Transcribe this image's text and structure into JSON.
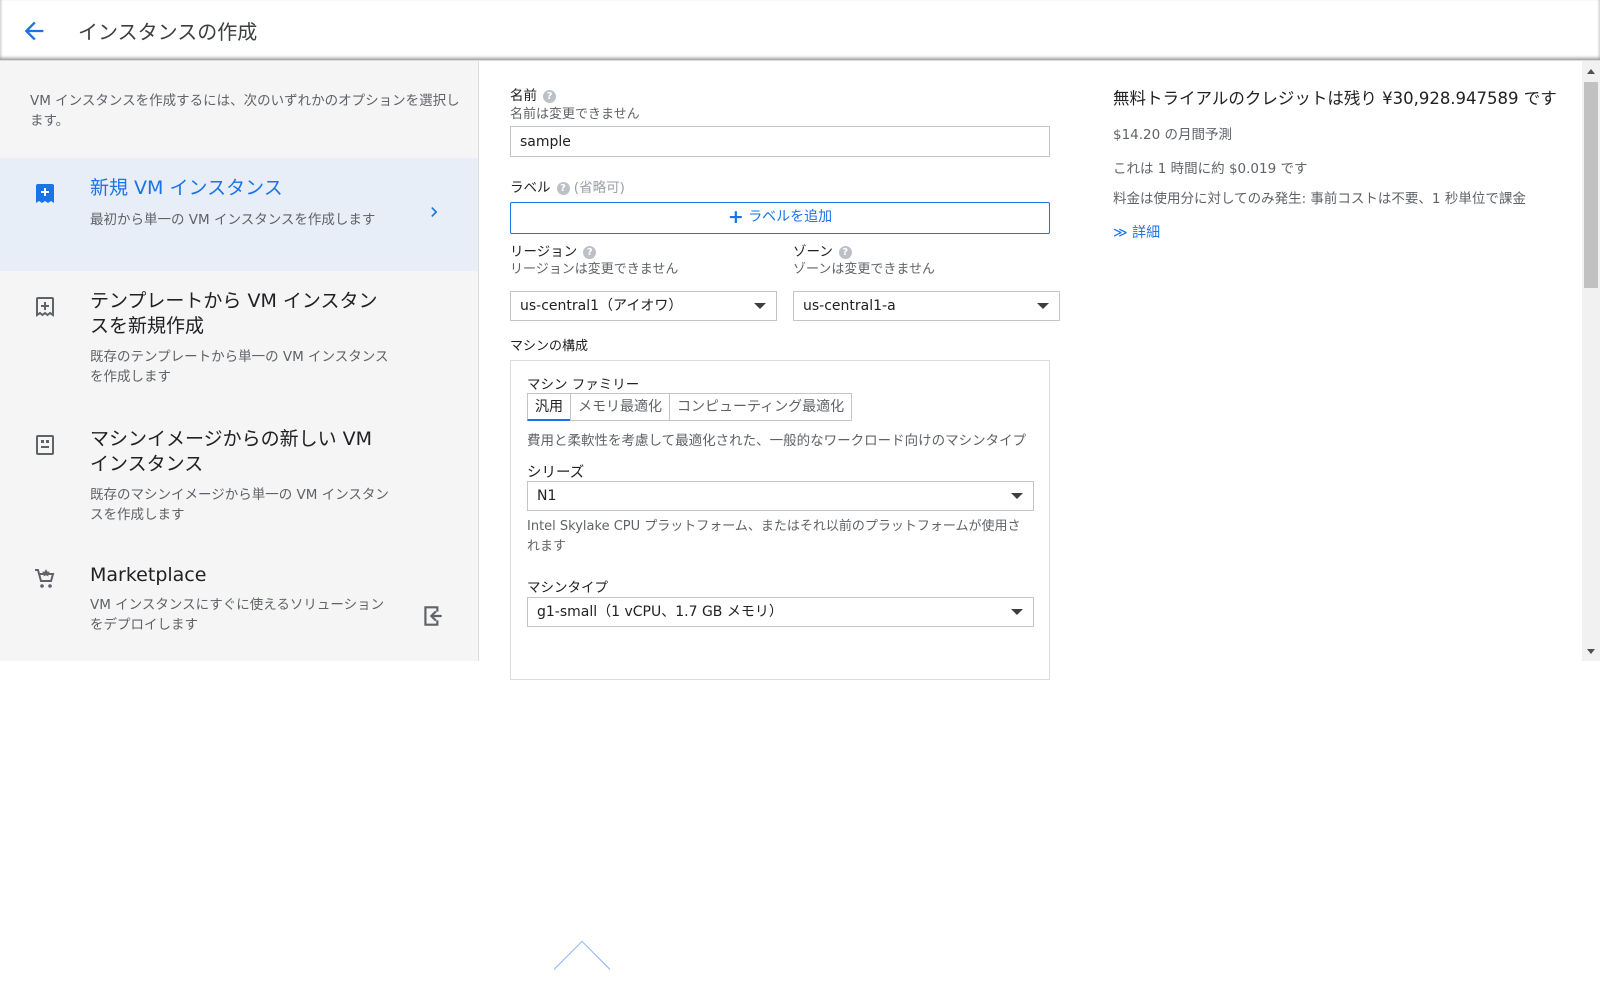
{
  "header": {
    "title": "インスタンスの作成"
  },
  "sidebar": {
    "intro": "VM インスタンスを作成するには、次のいずれかのオプションを選択します。",
    "options": [
      {
        "title": "新規 VM インスタンス",
        "desc": "最初から単一の VM インスタンスを作成します",
        "icon": "add-box-icon"
      },
      {
        "title": "テンプレートから VM インスタンスを新規作成",
        "desc": "既存のテンプレートから単一の VM インスタンスを作成します",
        "icon": "add-template-icon"
      },
      {
        "title": "マシンイメージからの新しい VM インスタンス",
        "desc": "既存のマシンイメージから単一の VM インスタンスを作成します",
        "icon": "machine-image-icon"
      },
      {
        "title": "Marketplace",
        "desc": "VM インスタンスにすぐに使えるソリューションをデプロイします",
        "icon": "cart-icon"
      }
    ]
  },
  "form": {
    "name_label": "名前",
    "name_sub": "名前は変更できません",
    "name_value": "sample",
    "label_label": "ラベル",
    "label_optional": "(省略可)",
    "add_label_button": "ラベルを追加",
    "region_label": "リージョン",
    "region_sub": "リージョンは変更できません",
    "region_value": "us-central1（アイオワ）",
    "zone_label": "ゾーン",
    "zone_sub": "ゾーンは変更できません",
    "zone_value": "us-central1-a",
    "machine_config_label": "マシンの構成",
    "machine_family_label": "マシン ファミリー",
    "family_tabs": [
      "汎用",
      "メモリ最適化",
      "コンピューティング最適化"
    ],
    "family_desc": "費用と柔軟性を考慮して最適化された、一般的なワークロード向けのマシンタイプ",
    "series_label": "シリーズ",
    "series_value": "N1",
    "series_desc": "Intel Skylake CPU プラットフォーム、またはそれ以前のプラットフォームが使用されます",
    "machine_type_label": "マシンタイプ",
    "machine_type_value": "g1-small（1 vCPU、1.7 GB メモリ）"
  },
  "summary": {
    "credit": "無料トライアルのクレジットは残り ¥30,928.947589 です",
    "monthly": "$14.20 の月間予測",
    "hourly": "これは 1 時間に約 $0.019 です",
    "billing": "料金は使用分に対してのみ発生: 事前コストは不要、1 秒単位で課金",
    "details": "詳細"
  },
  "colors": {
    "accent": "#1a73e8",
    "sidebar_bg": "#f5f5f5",
    "active_bg": "#e8eef7"
  }
}
